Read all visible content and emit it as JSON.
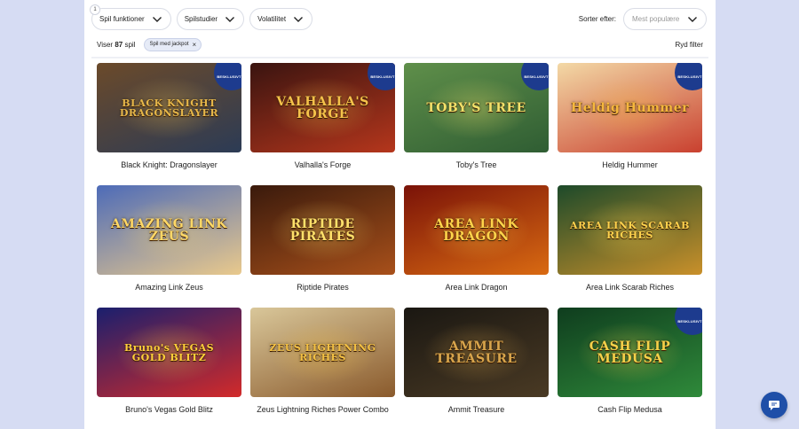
{
  "filters": {
    "active_count": "1",
    "buttons": [
      {
        "label": "Spil funktioner"
      },
      {
        "label": "Spilstudier"
      },
      {
        "label": "Volatilitet"
      }
    ]
  },
  "sort": {
    "label": "Sorter efter:",
    "selected": "Mest populære"
  },
  "results": {
    "prefix": "Viser",
    "count": "87",
    "suffix": "spil",
    "active_chip": "Spil med jackpot",
    "clear_label": "Ryd filter"
  },
  "badge_text": "BESKLUSIVT",
  "games": [
    {
      "name": "Black Knight: Dragonslayer",
      "art_title": "BLACK KNIGHT DRAGONSLAYER",
      "exclusive": true,
      "bg1": "#6b4a2a",
      "bg2": "#2c3b55",
      "accent": "#e7b84a"
    },
    {
      "name": "Valhalla's Forge",
      "art_title": "VALHALLA'S FORGE",
      "exclusive": true,
      "bg1": "#3a1410",
      "bg2": "#b5361c",
      "accent": "#f5c24a"
    },
    {
      "name": "Toby's Tree",
      "art_title": "TOBY'S TREE",
      "exclusive": true,
      "bg1": "#5f8f4a",
      "bg2": "#2f5d33",
      "accent": "#f3e16a"
    },
    {
      "name": "Heldig Hummer",
      "art_title": "Heldig Hummer",
      "exclusive": true,
      "bg1": "#f3d9a6",
      "bg2": "#c9402f",
      "accent": "#f6b73c"
    },
    {
      "name": "Amazing Link Zeus",
      "art_title": "AMAZING LINK ZEUS",
      "exclusive": false,
      "bg1": "#4d6bb8",
      "bg2": "#e9c98c",
      "accent": "#ffd866"
    },
    {
      "name": "Riptide Pirates",
      "art_title": "RIPTIDE PIRATES",
      "exclusive": false,
      "bg1": "#3a1a0c",
      "bg2": "#a8501a",
      "accent": "#ffe06a"
    },
    {
      "name": "Area Link Dragon",
      "art_title": "AREA LINK DRAGON",
      "exclusive": false,
      "bg1": "#7a1208",
      "bg2": "#d96a12",
      "accent": "#ffd34a"
    },
    {
      "name": "Area Link Scarab Riches",
      "art_title": "AREA LINK SCARAB RICHES",
      "exclusive": false,
      "bg1": "#1d4a2a",
      "bg2": "#c9902a",
      "accent": "#ffd24d"
    },
    {
      "name": "Bruno's Vegas Gold Blitz",
      "art_title": "Bruno's VEGAS GOLD BLITZ",
      "exclusive": false,
      "bg1": "#1a1f6e",
      "bg2": "#d22a2a",
      "accent": "#ffcf3a"
    },
    {
      "name": "Zeus Lightning Riches Power Combo",
      "art_title": "ZEUS LIGHTNING RICHES",
      "exclusive": false,
      "bg1": "#d9c79a",
      "bg2": "#8a5a2c",
      "accent": "#f3c043"
    },
    {
      "name": "Ammit Treasure",
      "art_title": "AMMIT TREASURE",
      "exclusive": false,
      "bg1": "#1a1712",
      "bg2": "#4a3a24",
      "accent": "#d8a54c"
    },
    {
      "name": "Cash Flip Medusa",
      "art_title": "CASH FLIP MEDUSA",
      "exclusive": true,
      "bg1": "#0f3d1e",
      "bg2": "#2f8a3a",
      "accent": "#f6d24a"
    }
  ]
}
